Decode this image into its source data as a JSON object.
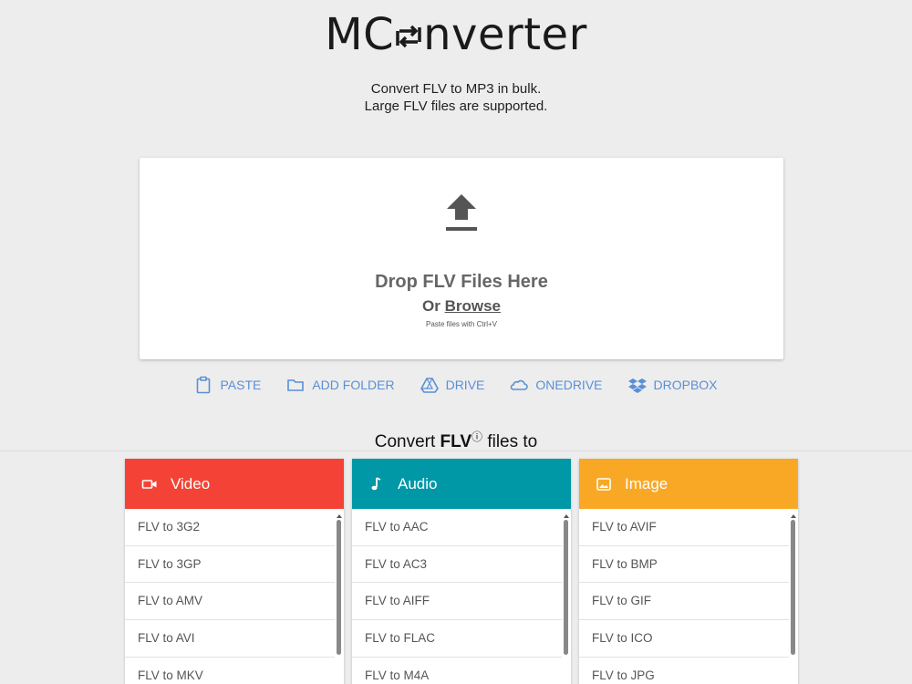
{
  "logo": {
    "prefix": "MC",
    "suffix": "nverter"
  },
  "tagline": {
    "line1": "Convert FLV to MP3 in bulk.",
    "line2": "Large FLV files are supported."
  },
  "dropzone": {
    "title": "Drop FLV Files Here",
    "or_label": "Or",
    "browse_label": "Browse",
    "hint": "Paste files with Ctrl+V"
  },
  "sources": [
    {
      "label": "PASTE",
      "icon": "clipboard-icon"
    },
    {
      "label": "ADD FOLDER",
      "icon": "folder-icon"
    },
    {
      "label": "DRIVE",
      "icon": "google-drive-icon"
    },
    {
      "label": "ONEDRIVE",
      "icon": "onedrive-icon"
    },
    {
      "label": "DROPBOX",
      "icon": "dropbox-icon"
    }
  ],
  "convert_heading": {
    "before": "Convert ",
    "format": "FLV",
    "info": "ⓘ",
    "after": " files to"
  },
  "panels": [
    {
      "title": "Video",
      "icon": "video-icon",
      "color": "#f44336",
      "items": [
        "FLV to 3G2",
        "FLV to 3GP",
        "FLV to AMV",
        "FLV to AVI",
        "FLV to MKV"
      ]
    },
    {
      "title": "Audio",
      "icon": "music-note-icon",
      "color": "#0097a7",
      "items": [
        "FLV to AAC",
        "FLV to AC3",
        "FLV to AIFF",
        "FLV to FLAC",
        "FLV to M4A"
      ]
    },
    {
      "title": "Image",
      "icon": "image-icon",
      "color": "#f9a825",
      "items": [
        "FLV to AVIF",
        "FLV to BMP",
        "FLV to GIF",
        "FLV to ICO",
        "FLV to JPG"
      ]
    }
  ],
  "colors": {
    "link_blue": "#5a8fd6",
    "background": "#ededed"
  }
}
